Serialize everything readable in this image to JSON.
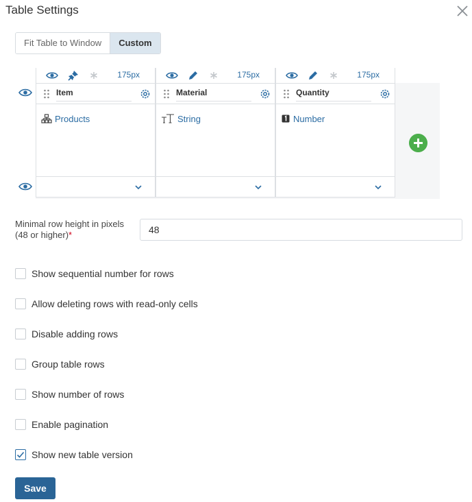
{
  "dialog": {
    "title": "Table Settings",
    "close_icon": "close-icon"
  },
  "width_mode": {
    "options": [
      "Fit Table to Window",
      "Custom"
    ],
    "selected": "Custom"
  },
  "columns": [
    {
      "name": "Item",
      "type_label": "Products",
      "type_icon": "catalog-icon",
      "width_label": "175px",
      "visible_icon": "eye-icon",
      "edit_icon": "pin-off-icon",
      "required_icon": "asterisk-icon"
    },
    {
      "name": "Material",
      "type_label": "String",
      "type_icon": "text-type-icon",
      "width_label": "175px",
      "visible_icon": "eye-icon",
      "edit_icon": "pencil-icon",
      "required_icon": "asterisk-icon"
    },
    {
      "name": "Quantity",
      "type_label": "Number",
      "type_icon": "number-type-icon",
      "width_label": "175px",
      "visible_icon": "eye-icon",
      "edit_icon": "pencil-icon",
      "required_icon": "asterisk-icon"
    }
  ],
  "row_height": {
    "label": "Minimal row height in pixels (48 or higher)",
    "required_mark": "*",
    "value": "48"
  },
  "options": [
    {
      "label": "Show sequential number for rows",
      "checked": false
    },
    {
      "label": "Allow deleting rows with read-only cells",
      "checked": false
    },
    {
      "label": "Disable adding rows",
      "checked": false
    },
    {
      "label": "Group table rows",
      "checked": false
    },
    {
      "label": "Show number of rows",
      "checked": false
    },
    {
      "label": "Enable pagination",
      "checked": false
    },
    {
      "label": "Show new table version",
      "checked": true
    }
  ],
  "save_label": "Save",
  "colors": {
    "accent": "#2b6ca3",
    "save_button": "#2a6496",
    "add_button": "#4cae4c",
    "required": "#d0021b",
    "segment_selected": "#dbe6ef"
  }
}
